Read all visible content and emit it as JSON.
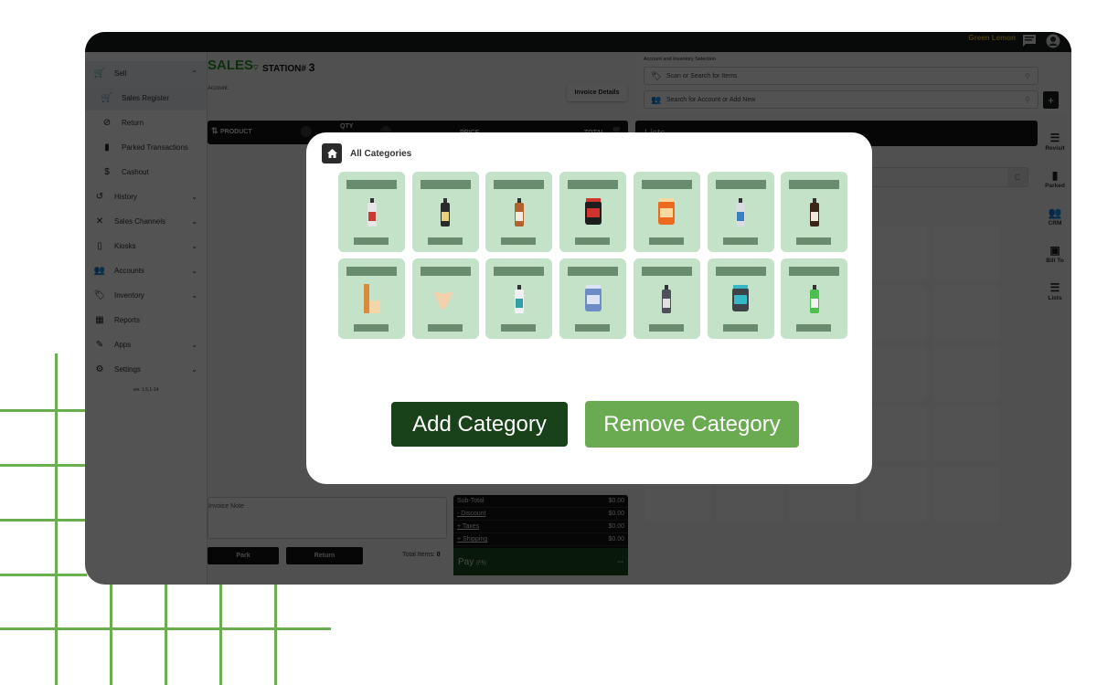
{
  "topbar": {
    "brand": "Green Lemon",
    "icons": [
      "chat-icon",
      "user-avatar-icon"
    ]
  },
  "sidebar": {
    "items": [
      {
        "label": "Sell",
        "icon": "cart-icon",
        "expanded": true
      },
      {
        "label": "Sales Register",
        "icon": "cart-icon",
        "sub": true,
        "active": true
      },
      {
        "label": "Return",
        "icon": "cart-off-icon",
        "sub": true
      },
      {
        "label": "Parked Transactions",
        "icon": "bookmark-icon",
        "sub": true
      },
      {
        "label": "Cashout",
        "icon": "dollar-icon",
        "sub": true
      },
      {
        "label": "History",
        "icon": "history-icon"
      },
      {
        "label": "Sales Channels",
        "icon": "channels-icon"
      },
      {
        "label": "Kiosks",
        "icon": "tablet-icon"
      },
      {
        "label": "Accounts",
        "icon": "people-icon"
      },
      {
        "label": "Inventory",
        "icon": "tag-icon"
      },
      {
        "label": "Reports",
        "icon": "chart-icon"
      },
      {
        "label": "Apps",
        "icon": "apps-icon"
      },
      {
        "label": "Settings",
        "icon": "gear-icon"
      }
    ],
    "version": "ver. 1.5.1-14"
  },
  "sales": {
    "title": "SALES",
    "station_label": "STATION#",
    "station_number": "3",
    "account_label": "Account:",
    "invoice_details": "Invoice Details",
    "columns": {
      "product": "PRODUCT",
      "qty": "QTY",
      "price": "PRICE",
      "total": "TOTAL"
    },
    "invoice_note_placeholder": "Invoice Note",
    "park": "Park",
    "return": "Return",
    "total_items_label": "Total Items:",
    "total_items_value": "0"
  },
  "totals": {
    "rows": [
      {
        "label": "Sub-Total",
        "value": "$0.00"
      },
      {
        "label": "- Discount",
        "value": "$0.00"
      },
      {
        "label": "+ Taxes",
        "value": "$0.00"
      },
      {
        "label": "+ Shipping",
        "value": "$0.00"
      }
    ],
    "pay_label": "Pay",
    "pay_sub": "(F5)",
    "pay_value": "--"
  },
  "right": {
    "section_label": "Account and Inventory Selection",
    "item_search_placeholder": "Scan or Search for Items",
    "account_search_placeholder": "Search for Account or Add New",
    "add_button": "+",
    "lists_title": "Lists",
    "side_actions": [
      {
        "label": "Revisit",
        "icon": "receipt-icon"
      },
      {
        "label": "Parked",
        "icon": "bookmark-icon"
      },
      {
        "label": "CRM",
        "icon": "people-icon"
      },
      {
        "label": "Bill To",
        "icon": "contact-card-icon"
      },
      {
        "label": "Lists",
        "icon": "list-icon"
      }
    ]
  },
  "modal": {
    "title": "All Categories",
    "tiles": [
      {
        "product": "white supplement bottle",
        "color": "#e6e6e6",
        "accent": "#c83a32"
      },
      {
        "product": "dark tincture bottle",
        "color": "#2a2a2a",
        "accent": "#e5d27a"
      },
      {
        "product": "amber pump bottle",
        "color": "#b4622d",
        "accent": "#f0ece2"
      },
      {
        "product": "black protein tub",
        "color": "#1e1e1e",
        "accent": "#d0342c"
      },
      {
        "product": "orange powder tub",
        "color": "#ec6a1f",
        "accent": "#f5d9a0"
      },
      {
        "product": "spray bottle",
        "color": "#d9dde2",
        "accent": "#3a7fc0"
      },
      {
        "product": "brown supplement bottle",
        "color": "#3b2418",
        "accent": "#efe9dc"
      },
      {
        "product": "wooden soap boxes",
        "color": "#d98a3a",
        "accent": "#f2d6a8"
      },
      {
        "product": "face mask",
        "color": "#f3d1ad",
        "accent": "#e9bf95"
      },
      {
        "product": "white vitamin bottle",
        "color": "#f2f2f2",
        "accent": "#2e9fa3"
      },
      {
        "product": "blue powder pouch",
        "color": "#6c8cc5",
        "accent": "#dbe4f4"
      },
      {
        "product": "clear tall bottle",
        "color": "#4d5058",
        "accent": "#e0e0e0"
      },
      {
        "product": "grey protein tub",
        "color": "#3d4247",
        "accent": "#37b6c5"
      },
      {
        "product": "green pump bottle",
        "color": "#4cc04e",
        "accent": "#f2f2f2"
      }
    ],
    "add_category": "Add Category",
    "remove_category": "Remove Category"
  },
  "colors": {
    "brand_green": "#2d8d2a",
    "dark_green_button": "#1a421a",
    "light_green_button": "#6aab51",
    "tile_bg": "#c4e2c8",
    "tile_bar": "#6a8c6e",
    "grid_line": "#6aae50",
    "brand_gold": "#d7b32d"
  }
}
